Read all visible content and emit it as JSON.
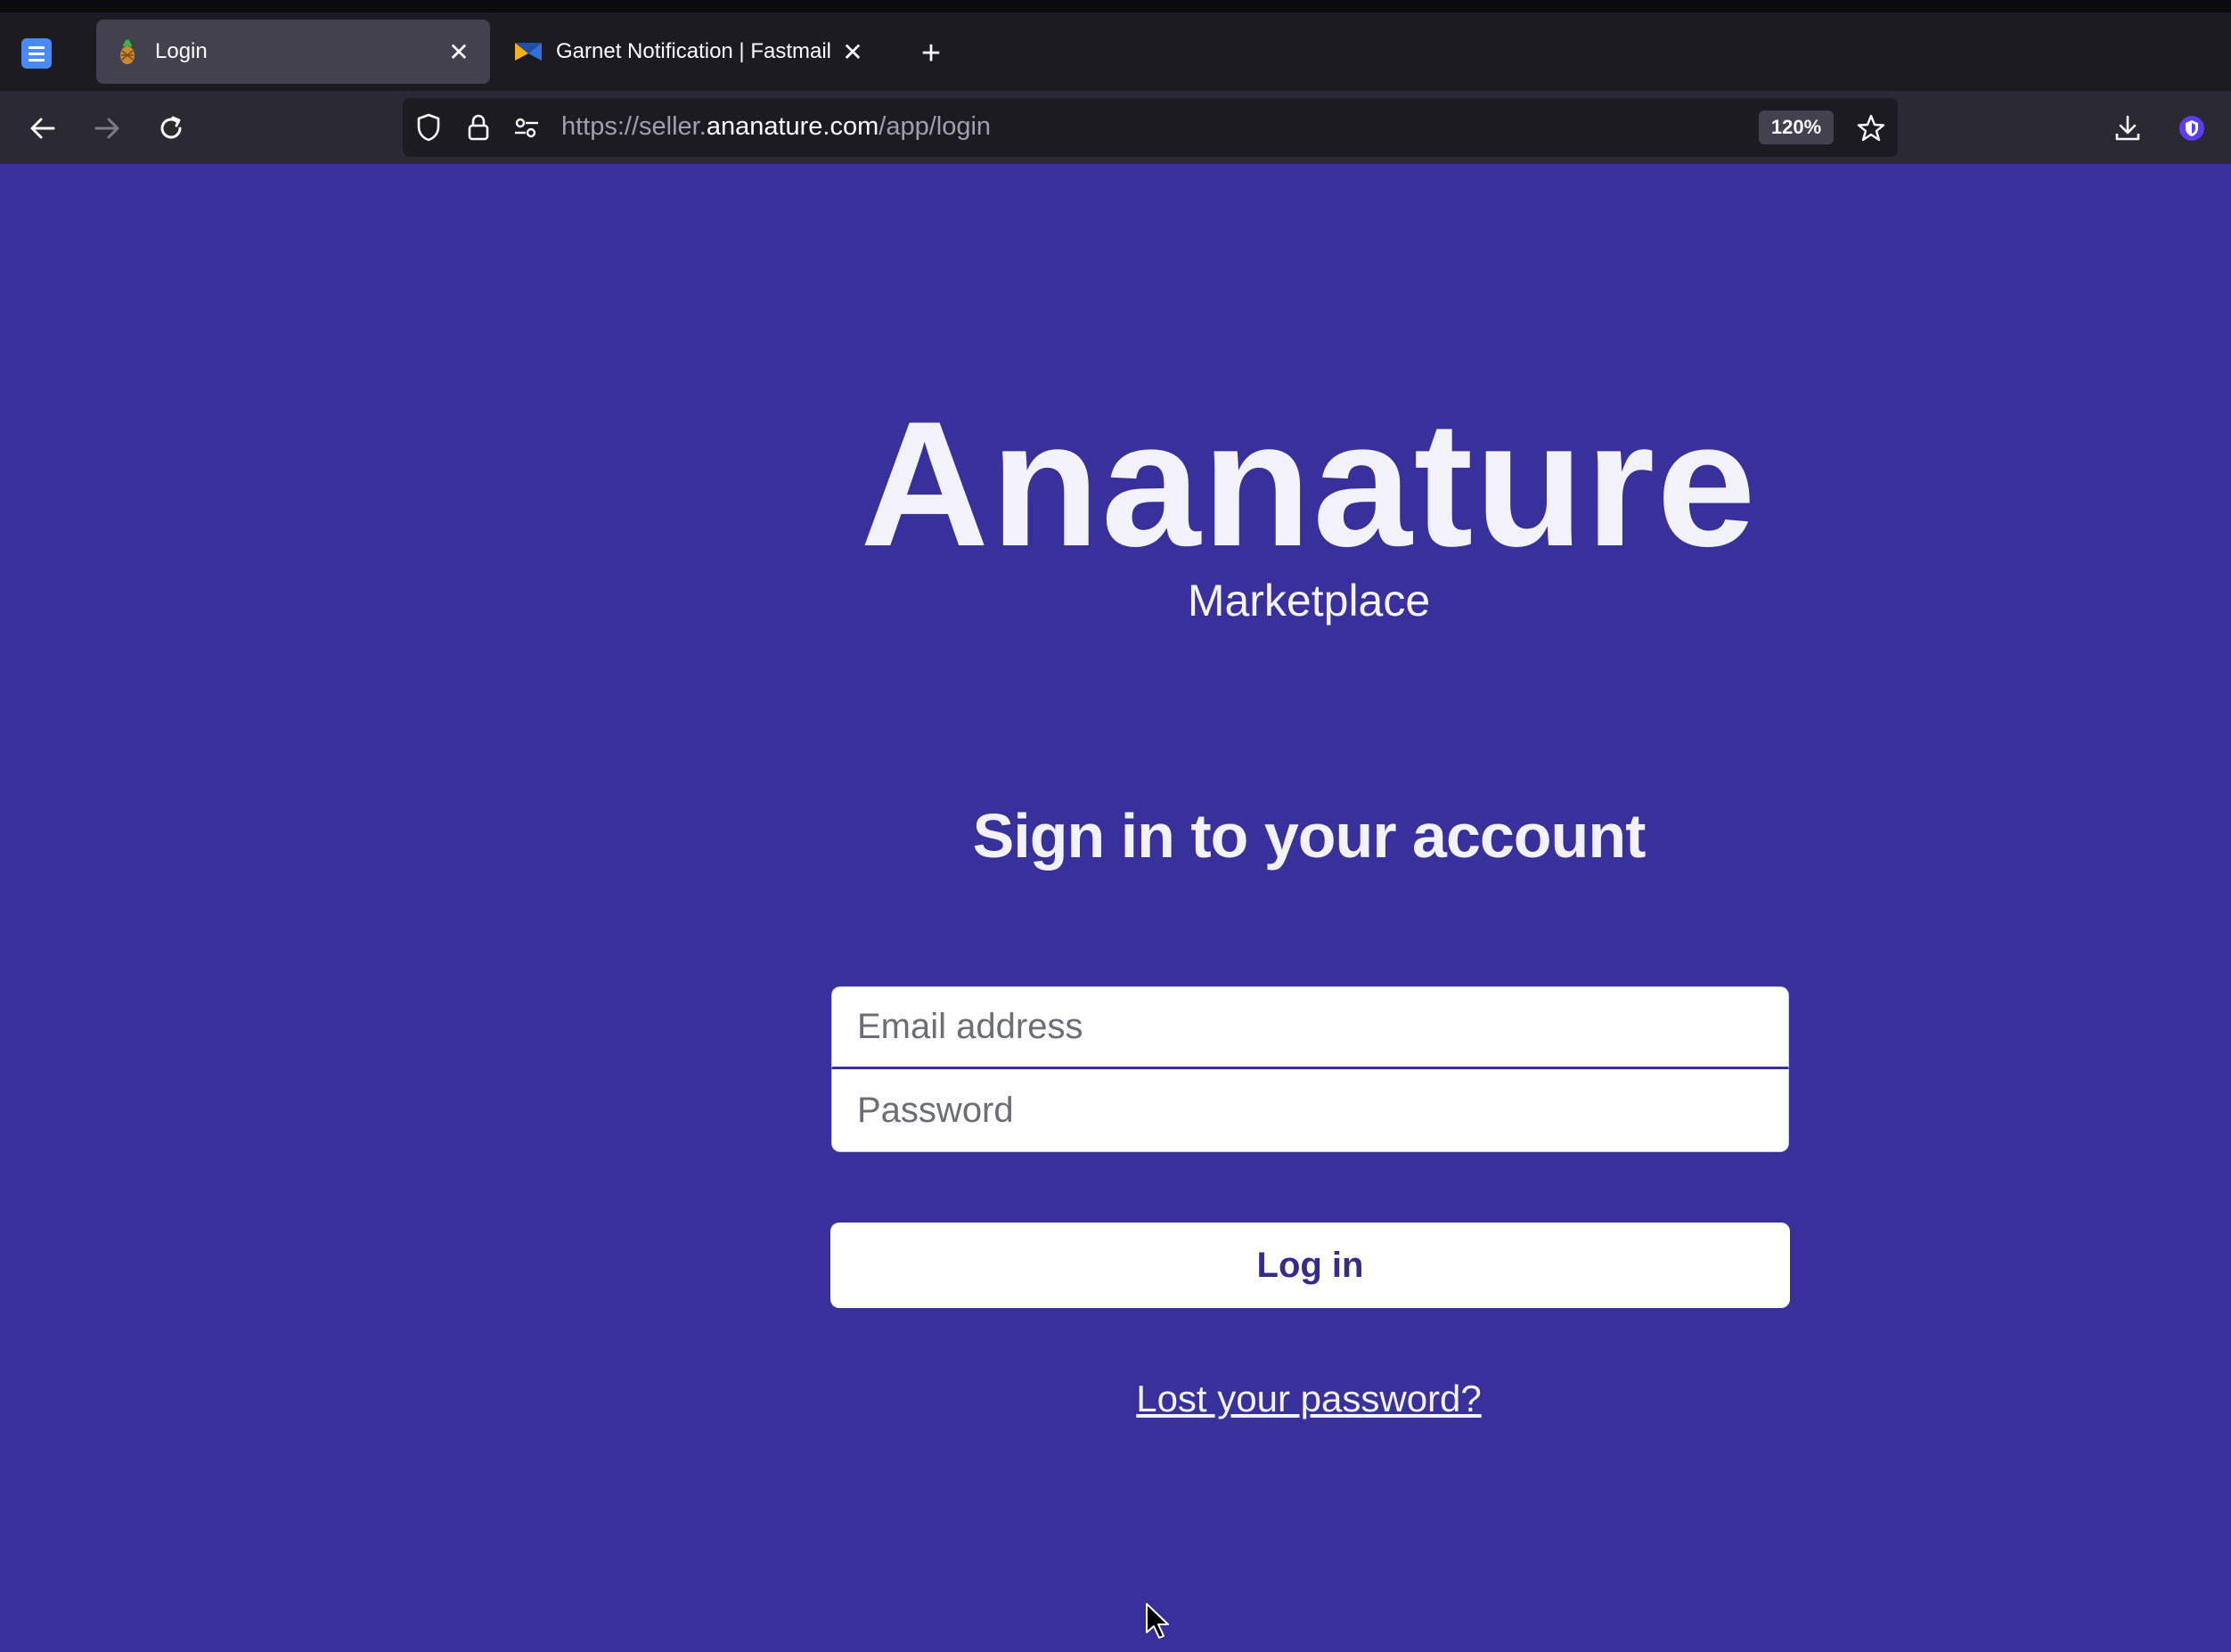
{
  "browser": {
    "tabs": [
      {
        "title": "Login",
        "active": true
      },
      {
        "title": "Garnet Notification | Fastmail",
        "active": false
      }
    ],
    "url": {
      "prefix": "https://seller.",
      "host": "ananature.com",
      "path": "/app/login"
    },
    "zoom": "120%"
  },
  "page": {
    "brand": "Ananature",
    "tagline": "Marketplace",
    "heading": "Sign in to your account",
    "email_placeholder": "Email address",
    "password_placeholder": "Password",
    "login_label": "Log in",
    "lost_password_label": "Lost your password?"
  },
  "colors": {
    "page_background": "#38319b",
    "button_text": "#332c8b"
  }
}
